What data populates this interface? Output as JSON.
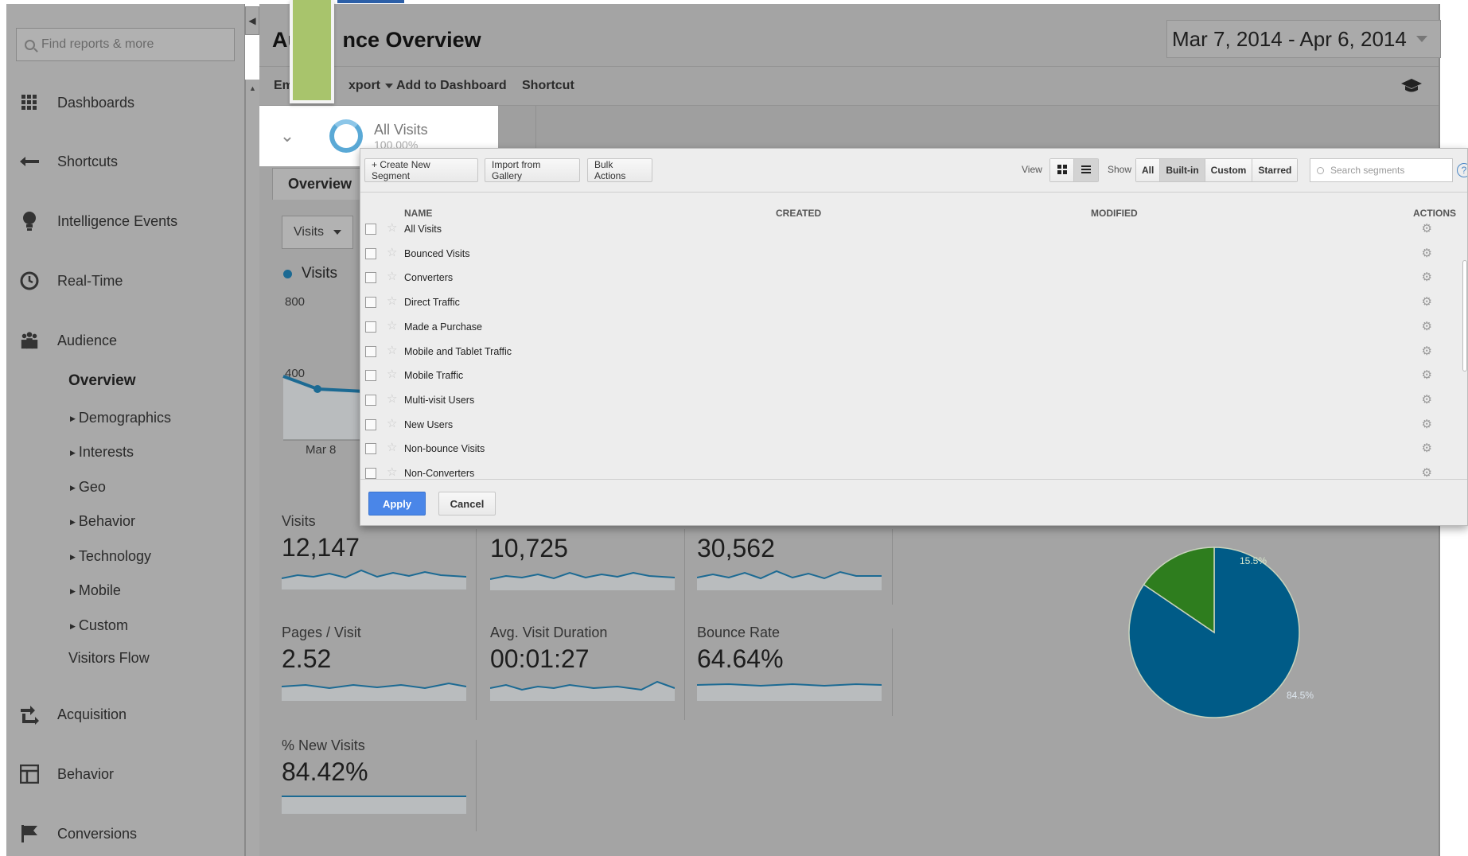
{
  "sidebar": {
    "search_placeholder": "Find reports & more",
    "nav": [
      {
        "label": "Dashboards",
        "icon": "dashboard-grid-icon"
      },
      {
        "label": "Shortcuts",
        "icon": "shortcut-arrow-icon"
      },
      {
        "label": "Intelligence Events",
        "icon": "lightbulb-icon"
      },
      {
        "label": "Real-Time",
        "icon": "clock-icon"
      },
      {
        "label": "Audience",
        "icon": "people-icon"
      }
    ],
    "audience_sub": {
      "overview": "Overview",
      "items": [
        "Demographics",
        "Interests",
        "Geo",
        "Behavior",
        "Technology",
        "Mobile",
        "Custom"
      ],
      "visitors_flow": "Visitors Flow"
    },
    "nav_bottom": [
      {
        "label": "Acquisition",
        "icon": "acquisition-arrows-icon"
      },
      {
        "label": "Behavior",
        "icon": "behavior-layout-icon"
      },
      {
        "label": "Conversions",
        "icon": "flag-icon"
      }
    ]
  },
  "header": {
    "title": "Au       nce Overview",
    "date_range": "Mar 7, 2014 - Apr 6, 2014"
  },
  "toolbar": {
    "email": "Em",
    "export": "xport",
    "add_dashboard": "Add to Dashboard",
    "shortcut": "Shortcut"
  },
  "segment": {
    "name": "All Visits",
    "pct": "100.00%"
  },
  "tab": "Overview",
  "metric_select": "Visits",
  "chart": {
    "legend": "Visits",
    "y_top": "800",
    "y_mid": "400",
    "x_label": "Mar 8"
  },
  "metrics": [
    {
      "label": "Visits",
      "value": "12,147"
    },
    {
      "label": "",
      "value": "10,725"
    },
    {
      "label": "",
      "value": "30,562"
    },
    {
      "label": "Pages / Visit",
      "value": "2.52"
    },
    {
      "label": "Avg. Visit Duration",
      "value": "00:01:27"
    },
    {
      "label": "Bounce Rate",
      "value": "64.64%"
    },
    {
      "label": "% New Visits",
      "value": "84.42%"
    }
  ],
  "chart_data": {
    "type": "pie",
    "slices": [
      {
        "label": "84.5%",
        "value": 84.5,
        "color": "#005b87"
      },
      {
        "label": "15.5%",
        "value": 15.5,
        "color": "#2e7d1e"
      }
    ]
  },
  "modal": {
    "create_btn": "+ Create New Segment",
    "import_btn": "Import from Gallery",
    "bulk_btn": "Bulk Actions",
    "view_label": "View",
    "show_label": "Show",
    "show_options": [
      "All",
      "Built-in",
      "Custom",
      "Starred"
    ],
    "search_placeholder": "Search segments",
    "columns": {
      "name": "NAME",
      "created": "CREATED",
      "modified": "MODIFIED",
      "actions": "ACTIONS"
    },
    "rows": [
      "All Visits",
      "Bounced Visits",
      "Converters",
      "Direct Traffic",
      "Made a Purchase",
      "Mobile and Tablet Traffic",
      "Mobile Traffic",
      "Multi-visit Users",
      "New Users",
      "Non-bounce Visits",
      "Non-Converters"
    ],
    "apply": "Apply",
    "cancel": "Cancel"
  }
}
